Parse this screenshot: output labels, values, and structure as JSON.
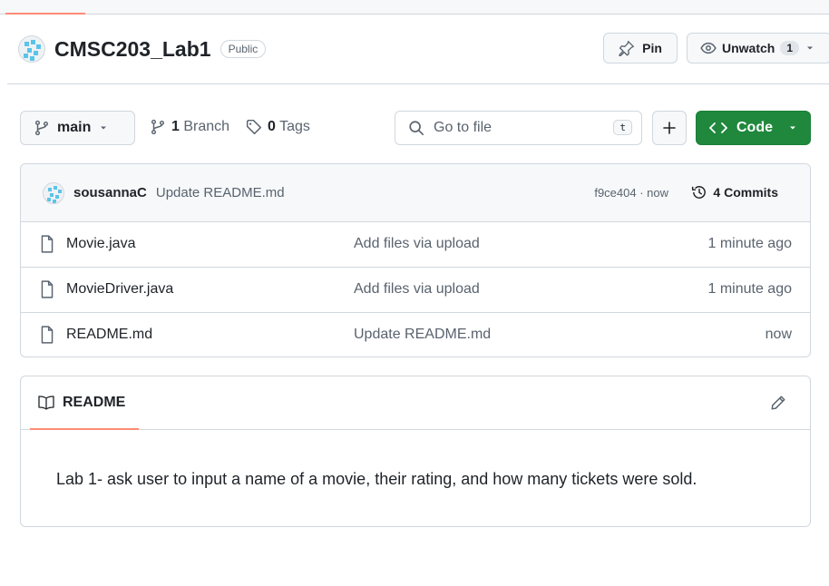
{
  "repo": {
    "name": "CMSC203_Lab1",
    "visibility": "Public"
  },
  "actions": {
    "pin_label": "Pin",
    "watch_label": "Unwatch",
    "watch_count": "1"
  },
  "toolbar": {
    "branch": "main",
    "branch_count": "1",
    "branch_label": "Branch",
    "tag_count": "0",
    "tag_label": "Tags",
    "search_placeholder": "Go to file",
    "search_shortcut": "t",
    "code_label": "Code"
  },
  "latest_commit": {
    "author": "sousannaC",
    "message": "Update README.md",
    "hash_time": "f9ce404 · now",
    "commits_label": "4 Commits"
  },
  "files": [
    {
      "name": "Movie.java",
      "message": "Add files via upload",
      "age": "1 minute ago"
    },
    {
      "name": "MovieDriver.java",
      "message": "Add files via upload",
      "age": "1 minute ago"
    },
    {
      "name": "README.md",
      "message": "Update README.md",
      "age": "now"
    }
  ],
  "readme": {
    "tab_label": "README",
    "content": "Lab 1- ask user to input a name of a movie, their rating, and how many tickets were sold."
  },
  "colors": {
    "accent_underline": "#fd8c73",
    "code_button": "#1f883d",
    "avatar_pattern": "#5cc3e8"
  }
}
